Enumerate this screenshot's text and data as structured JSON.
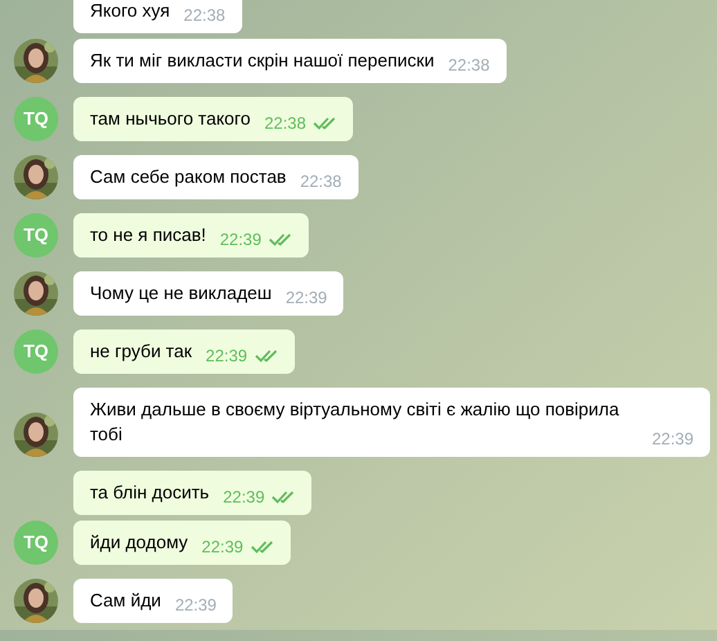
{
  "messages": [
    {
      "kind": "incoming",
      "text": "Якого хуя",
      "time": "22:38",
      "avatar": false
    },
    {
      "kind": "incoming",
      "text": "Як ти міг викласти скрін нашої переписки",
      "time": "22:38",
      "avatar": true
    },
    {
      "kind": "outgoing",
      "text": "там нычього такого",
      "time": "22:38",
      "avatar": true,
      "avatar_text": "TQ",
      "read": true
    },
    {
      "kind": "incoming",
      "text": "Сам себе раком постав",
      "time": "22:38",
      "avatar": true
    },
    {
      "kind": "outgoing",
      "text": "то не я писав!",
      "time": "22:39",
      "avatar": true,
      "avatar_text": "TQ",
      "read": true
    },
    {
      "kind": "incoming",
      "text": "Чому це не викладеш",
      "time": "22:39",
      "avatar": true
    },
    {
      "kind": "outgoing",
      "text": "не груби так",
      "time": "22:39",
      "avatar": true,
      "avatar_text": "TQ",
      "read": true
    },
    {
      "kind": "incoming",
      "text": "Живи дальше в своєму віртуальному світі є жалію що повірила тобі",
      "time": "22:39",
      "avatar": true
    },
    {
      "kind": "outgoing",
      "text": "та блін досить",
      "time": "22:39",
      "avatar": false,
      "read": true
    },
    {
      "kind": "outgoing",
      "text": "йди додому",
      "time": "22:39",
      "avatar": true,
      "avatar_text": "TQ",
      "read": true
    },
    {
      "kind": "incoming",
      "text": "Сам йди",
      "time": "22:39",
      "avatar": true
    }
  ]
}
